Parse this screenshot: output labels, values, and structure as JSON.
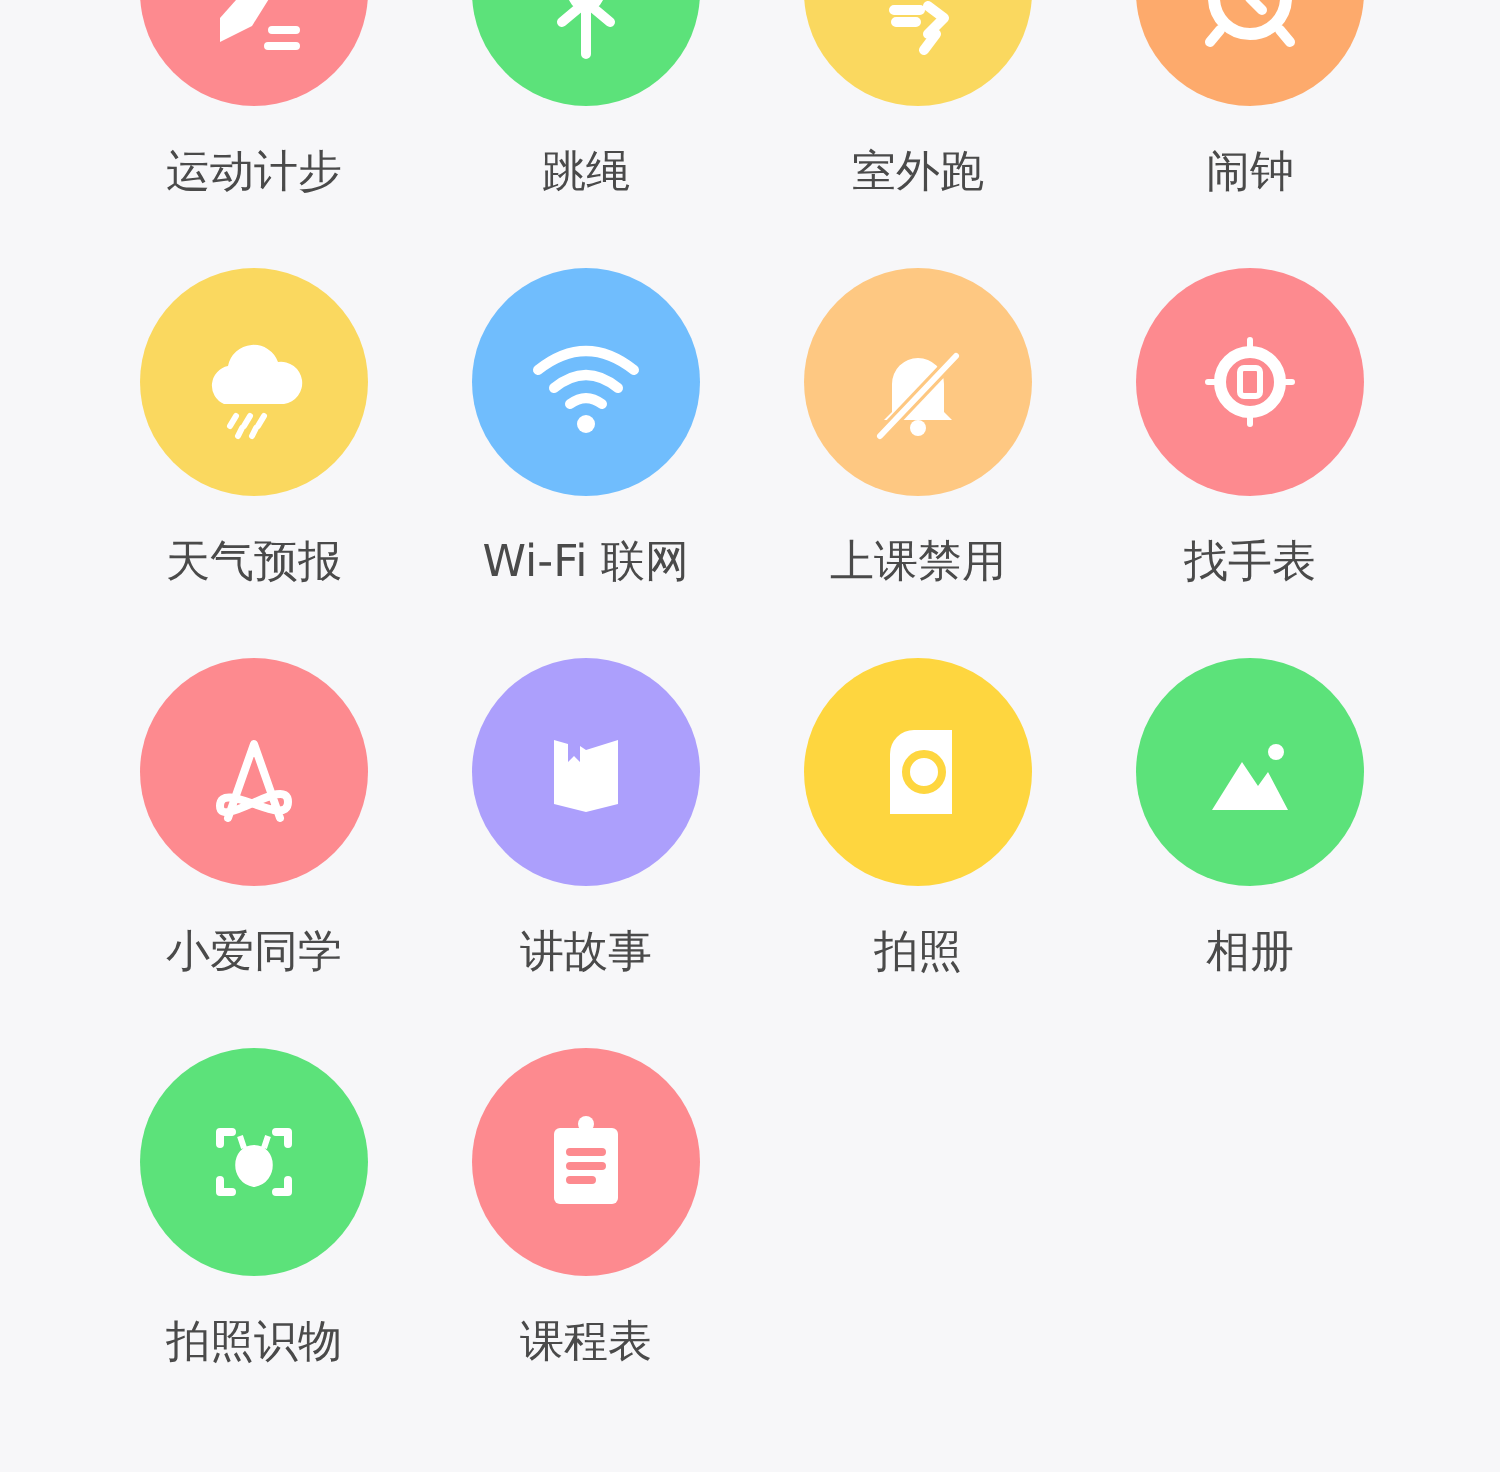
{
  "apps": [
    {
      "label": "运动计步",
      "color": "#fd8a8f"
    },
    {
      "label": "跳绳",
      "color": "#5ce27a"
    },
    {
      "label": "室外跑",
      "color": "#fad85f"
    },
    {
      "label": "闹钟",
      "color": "#fdaa6c"
    },
    {
      "label": "天气预报",
      "color": "#fad85f"
    },
    {
      "label": "Wi-Fi 联网",
      "color": "#70bdfd"
    },
    {
      "label": "上课禁用",
      "color": "#fec882"
    },
    {
      "label": "找手表",
      "color": "#fd8a8f"
    },
    {
      "label": "小爱同学",
      "color": "#fd8a8f"
    },
    {
      "label": "讲故事",
      "color": "#ac9ffc"
    },
    {
      "label": "拍照",
      "color": "#fed63f"
    },
    {
      "label": "相册",
      "color": "#5ce27a"
    },
    {
      "label": "拍照识物",
      "color": "#5ce27a"
    },
    {
      "label": "课程表",
      "color": "#fd8a8f"
    }
  ]
}
